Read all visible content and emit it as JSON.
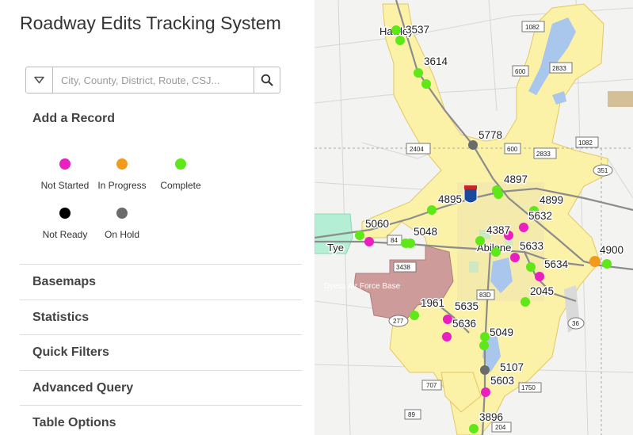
{
  "app": {
    "title": "Roadway Edits Tracking System"
  },
  "search": {
    "placeholder": "City, County, District, Route, CSJ..."
  },
  "add_record": {
    "label": "Add a Record"
  },
  "legend": [
    {
      "label": "Not Started",
      "color": "#e91fbf"
    },
    {
      "label": "In Progress",
      "color": "#f39a1c"
    },
    {
      "label": "Complete",
      "color": "#5fe817"
    },
    {
      "label": "Not Ready",
      "color": "#000000"
    },
    {
      "label": "On Hold",
      "color": "#6b6b6b"
    }
  ],
  "sections": [
    {
      "label": "Basemaps"
    },
    {
      "label": "Statistics"
    },
    {
      "label": "Quick Filters"
    },
    {
      "label": "Advanced Query"
    },
    {
      "label": "Table Options"
    }
  ],
  "map": {
    "towns": [
      "Hawley",
      "Tye",
      "Abilene",
      "Dyess Air Force Base"
    ],
    "highway_shields": [
      "1082",
      "600",
      "2833",
      "2404",
      "600",
      "2833",
      "1082",
      "351",
      "84",
      "3438",
      "83D",
      "277",
      "36",
      "707",
      "1750",
      "89",
      "204"
    ],
    "records": [
      {
        "id": "3537",
        "status": "Complete"
      },
      {
        "id": "3614",
        "status": "Complete"
      },
      {
        "id": "5778",
        "status": "On Hold"
      },
      {
        "id": "4897",
        "status": "Complete"
      },
      {
        "id": "4895",
        "status": "Complete"
      },
      {
        "id": "4899",
        "status": "Complete"
      },
      {
        "id": "5632",
        "status": "Not Started"
      },
      {
        "id": "5060",
        "status": "Not Started"
      },
      {
        "id": "5048",
        "status": "Complete"
      },
      {
        "id": "4387",
        "status": "Complete"
      },
      {
        "id": "5633",
        "status": "Not Started"
      },
      {
        "id": "4900",
        "status": "In Progress"
      },
      {
        "id": "5634",
        "status": "Not Started"
      },
      {
        "id": "2045",
        "status": "Complete"
      },
      {
        "id": "1961",
        "status": "Complete"
      },
      {
        "id": "5635",
        "status": "Not Started"
      },
      {
        "id": "5636",
        "status": "Not Started"
      },
      {
        "id": "5049",
        "status": "Complete"
      },
      {
        "id": "5107",
        "status": "On Hold"
      },
      {
        "id": "5603",
        "status": "Not Started"
      },
      {
        "id": "3896",
        "status": "Complete"
      }
    ]
  }
}
